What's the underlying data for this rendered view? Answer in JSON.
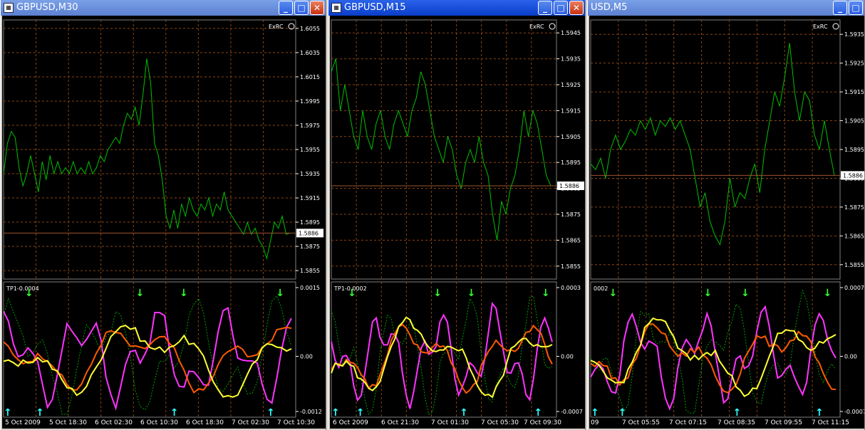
{
  "windows": [
    {
      "id": "w1",
      "title": "GBPUSD,M30",
      "active": false,
      "broker_label": "ExRC",
      "price_ticks": [
        "1.6055",
        "1.6035",
        "1.6015",
        "1.5995",
        "1.5975",
        "1.5955",
        "1.5935",
        "1.5915",
        "1.5895",
        "1.5875",
        "1.5855"
      ],
      "current_price": "1.5886",
      "indicator_label": "TP1-0.0004",
      "indicator_ticks": [
        "0.0015",
        "0.00",
        "-0.0012"
      ],
      "time_ticks": [
        "5 Oct 2009",
        "5 Oct 18:30",
        "6 Oct 02:30",
        "6 Oct 10:30",
        "6 Oct 18:30",
        "7 Oct 02:30",
        "7 Oct 10:30"
      ]
    },
    {
      "id": "w2",
      "title": "GBPUSD,M15",
      "active": true,
      "broker_label": "ExRC",
      "price_ticks": [
        "1.5945",
        "1.5935",
        "1.5925",
        "1.5915",
        "1.5905",
        "1.5895",
        "1.5885",
        "1.5875",
        "1.5865",
        "1.5855"
      ],
      "current_price": "1.5886",
      "indicator_label": "TP1-0.0002",
      "indicator_ticks": [
        "0.0003",
        "0.00",
        "-0.0007"
      ],
      "time_ticks": [
        "6 Oct 2009",
        "6 Oct 21:30",
        "7 Oct 01:30",
        "7 Oct 05:30",
        "7 Oct 09:30"
      ]
    },
    {
      "id": "w3",
      "title": "USD,M5",
      "active": false,
      "broker_label": "ExRC",
      "price_ticks": [
        "1.5935",
        "1.5925",
        "1.5915",
        "1.5905",
        "1.5895",
        "1.5885",
        "1.5875",
        "1.5865",
        "1.5855"
      ],
      "current_price": "1.5886",
      "indicator_label": "0002",
      "indicator_ticks": [
        "0.0007",
        "0.00",
        "-0.0007"
      ],
      "time_ticks": [
        "09",
        "7 Oct 05:55",
        "7 Oct 07:15",
        "7 Oct 08:35",
        "7 Oct 09:55",
        "7 Oct 11:15"
      ]
    }
  ],
  "colors": {
    "background": "#000000",
    "grid": "#8b4513",
    "price_line": "#00c000",
    "current_price_line": "#a0522d",
    "magenta": "#ff33ff",
    "orange": "#ff5a00",
    "yellow": "#ffff33",
    "green_dotted": "#00a000",
    "arrow_down": "#33ff33",
    "arrow_up": "#33ffff"
  },
  "chart_data": [
    {
      "type": "line",
      "window": "GBPUSD,M30",
      "ylim": [
        1.5848,
        1.6062
      ],
      "current": 1.5886,
      "series": [
        {
          "values": [
            1.5935,
            1.596,
            1.597,
            1.5965,
            1.594,
            1.5925,
            1.5935,
            1.595,
            1.5935,
            1.592,
            1.5945,
            1.593,
            1.595,
            1.5935,
            1.5945,
            1.5935,
            1.594,
            1.5935,
            1.5945,
            1.5935,
            1.594,
            1.5935,
            1.5945,
            1.5935,
            1.594,
            1.595,
            1.5945,
            1.5955,
            1.596,
            1.5965,
            1.596,
            1.5975,
            1.5985,
            1.598,
            1.599,
            1.5975,
            1.6,
            1.603,
            1.601,
            1.596,
            1.595,
            1.593,
            1.59,
            1.589,
            1.5905,
            1.589,
            1.591,
            1.59,
            1.5915,
            1.5905,
            1.59,
            1.591,
            1.5905,
            1.5915,
            1.59,
            1.591,
            1.5905,
            1.592,
            1.5905,
            1.59,
            1.5895,
            1.589,
            1.5885,
            1.5895,
            1.5885,
            1.589,
            1.588,
            1.5875,
            1.5865,
            1.588,
            1.5895,
            1.589,
            1.59,
            1.5885,
            1.5886
          ]
        }
      ]
    },
    {
      "type": "line",
      "window": "GBPUSD,M15",
      "ylim": [
        1.585,
        1.595
      ],
      "current": 1.5886,
      "series": [
        {
          "values": [
            1.593,
            1.5935,
            1.5915,
            1.5925,
            1.5915,
            1.5905,
            1.59,
            1.5915,
            1.5905,
            1.59,
            1.591,
            1.5915,
            1.5905,
            1.59,
            1.591,
            1.5915,
            1.591,
            1.5905,
            1.5915,
            1.592,
            1.593,
            1.5925,
            1.5915,
            1.5905,
            1.59,
            1.5895,
            1.5905,
            1.59,
            1.589,
            1.5885,
            1.5895,
            1.59,
            1.5895,
            1.5905,
            1.5895,
            1.589,
            1.5875,
            1.5865,
            1.588,
            1.5875,
            1.5885,
            1.589,
            1.59,
            1.5915,
            1.5905,
            1.5915,
            1.591,
            1.59,
            1.589,
            1.5886
          ]
        }
      ]
    },
    {
      "type": "line",
      "window": "USD,M5",
      "ylim": [
        1.585,
        1.594
      ],
      "current": 1.5886,
      "series": [
        {
          "values": [
            1.589,
            1.5888,
            1.5892,
            1.5885,
            1.5895,
            1.59,
            1.5895,
            1.5898,
            1.5902,
            1.59,
            1.5905,
            1.5902,
            1.5906,
            1.59,
            1.5905,
            1.5903,
            1.5906,
            1.5902,
            1.5905,
            1.59,
            1.5895,
            1.5885,
            1.5875,
            1.588,
            1.587,
            1.5865,
            1.5862,
            1.587,
            1.5885,
            1.5875,
            1.588,
            1.5878,
            1.5885,
            1.589,
            1.588,
            1.5895,
            1.5905,
            1.5915,
            1.591,
            1.592,
            1.5932,
            1.5915,
            1.5905,
            1.5915,
            1.5912,
            1.59,
            1.5895,
            1.5905,
            1.5895,
            1.5886
          ]
        }
      ]
    }
  ]
}
